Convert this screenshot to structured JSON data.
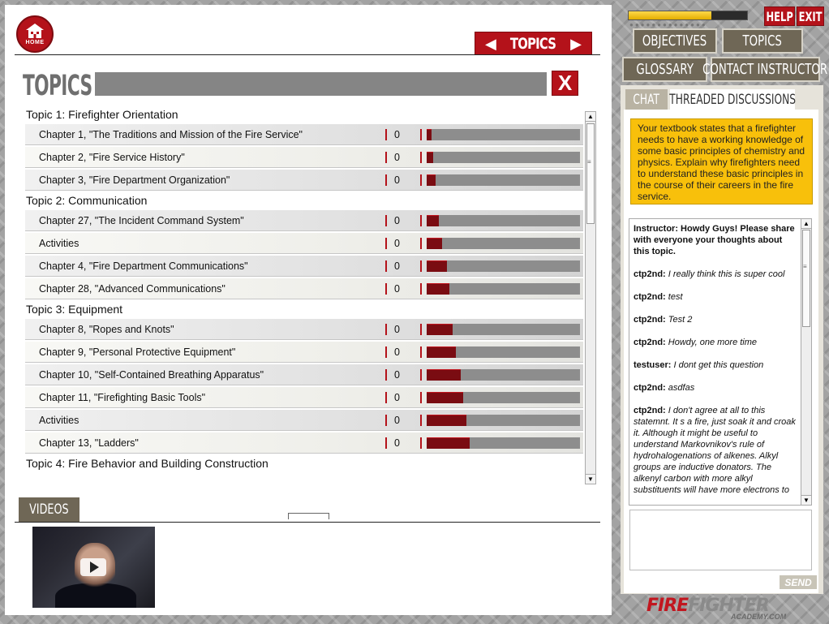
{
  "header": {
    "home_label": "HOME",
    "nav_title": "TOPICS",
    "section_title": "TOPICS",
    "close_label": "X"
  },
  "topics": [
    {
      "title": "Topic 1: Firefighter Orientation",
      "chapters": [
        {
          "name": "Chapter 1, \"The Traditions and Mission of the Fire Service\"",
          "count": "0",
          "progress": 0.02
        },
        {
          "name": "Chapter 2, \"Fire Service History\"",
          "count": "0",
          "progress": 0.04
        },
        {
          "name": "Chapter 3, \"Fire Department Organization\"",
          "count": "0",
          "progress": 0.06
        }
      ]
    },
    {
      "title": "Topic 2: Communication",
      "chapters": [
        {
          "name": "Chapter 27, \"The Incident Command System\"",
          "count": "0",
          "progress": 0.08
        },
        {
          "name": "Activities",
          "count": "0",
          "progress": 0.1
        },
        {
          "name": "Chapter 4, \"Fire Department Communications\"",
          "count": "0",
          "progress": 0.13
        },
        {
          "name": "Chapter 28, \"Advanced Communications\"",
          "count": "0",
          "progress": 0.15
        }
      ]
    },
    {
      "title": "Topic 3: Equipment",
      "chapters": [
        {
          "name": "Chapter 8, \"Ropes and Knots\"",
          "count": "0",
          "progress": 0.17
        },
        {
          "name": "Chapter 9, \"Personal Protective Equipment\"",
          "count": "0",
          "progress": 0.19
        },
        {
          "name": "Chapter 10, \"Self-Contained Breathing Apparatus\"",
          "count": "0",
          "progress": 0.22
        },
        {
          "name": "Chapter 11, \"Firefighting Basic Tools\"",
          "count": "0",
          "progress": 0.24
        },
        {
          "name": "Activities",
          "count": "0",
          "progress": 0.26
        },
        {
          "name": "Chapter 13, \"Ladders\"",
          "count": "0",
          "progress": 0.28
        }
      ]
    },
    {
      "title": "Topic 4: Fire Behavior and Building Construction",
      "chapters": []
    }
  ],
  "videos": {
    "tab_label": "VIDEOS"
  },
  "sidebar": {
    "course_progress": 0.7,
    "help_label": "HELP",
    "exit_label": "EXIT",
    "objectives_label": "OBJECTIVES",
    "topics_label": "TOPICS",
    "glossary_label": "GLOSSARY",
    "contact_label": "CONTACT INSTRUCTOR",
    "chat_tab": "CHAT",
    "threaded_tab": "THREADED DISCUSSIONS",
    "question": "Your textbook states that a firefighter needs to have a working knowledge of some basic principles of chemistry and physics.  Explain why firefighters need to understand these basic principles in the course of their careers in the fire service.",
    "instructor_message": "Instructor: Howdy Guys! Please share with everyone your thoughts about this topic.",
    "messages": [
      {
        "user": "ctp2nd:",
        "text": "I really think this is super cool"
      },
      {
        "user": "ctp2nd:",
        "text": "test"
      },
      {
        "user": "ctp2nd:",
        "text": "Test 2"
      },
      {
        "user": "ctp2nd:",
        "text": "Howdy, one more time"
      },
      {
        "user": "testuser:",
        "text": "I dont get this question"
      },
      {
        "user": "ctp2nd:",
        "text": "asdfas"
      },
      {
        "user": "ctp2nd:",
        "text": "I don't agree at all to this statemnt. It s a fire, just soak it and croak it. Although it might be useful to understand Markovnikov's rule of hydrohalogenations of alkenes. Alkyl groups are inductive donators. The alkenyl carbon with more alkyl substituents will have more electrons to"
      }
    ],
    "send_label": "SEND",
    "brand_fire": "FIRE",
    "brand_fighter": "FIGHTER",
    "brand_sub": "ACADEMY.COM"
  }
}
